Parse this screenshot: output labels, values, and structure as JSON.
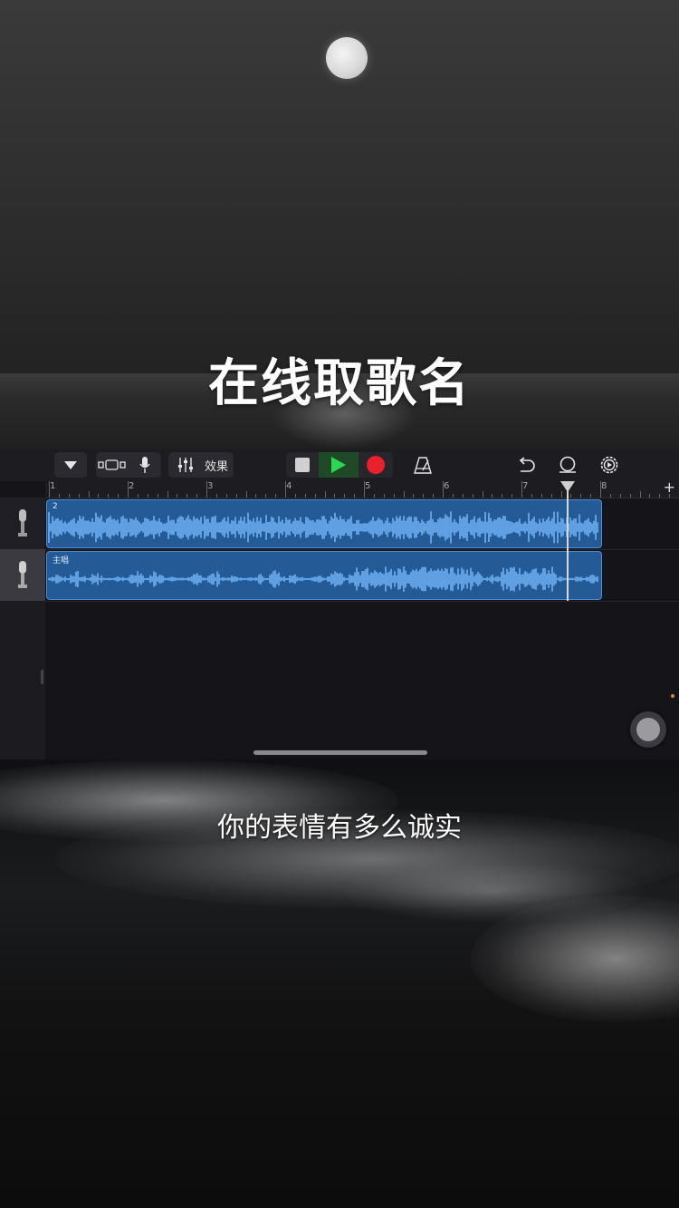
{
  "overlay": {
    "title": "在线取歌名",
    "lyric": "你的表情有多么诚实"
  },
  "toolbar": {
    "fx_label": "效果",
    "icons": [
      "tracks-dropdown-icon",
      "track-view-icon",
      "microphone-icon",
      "mixer-icon",
      "stop-icon",
      "play-icon",
      "record-icon",
      "metronome-icon",
      "undo-icon",
      "loop-icon",
      "settings-icon"
    ],
    "colors": {
      "play": "#2fd651",
      "record": "#e8212b",
      "play_bg": "#1f4a28"
    }
  },
  "ruler": {
    "bars": [
      "1",
      "2",
      "3",
      "4",
      "5",
      "6",
      "7",
      "8"
    ],
    "add_symbol": "+"
  },
  "tracks": [
    {
      "name": "2",
      "instrument": "microphone",
      "color": "#4a8fd6"
    },
    {
      "name": "主唱",
      "instrument": "microphone",
      "color": "#4a8fd6"
    }
  ],
  "add_track_symbol": "+"
}
